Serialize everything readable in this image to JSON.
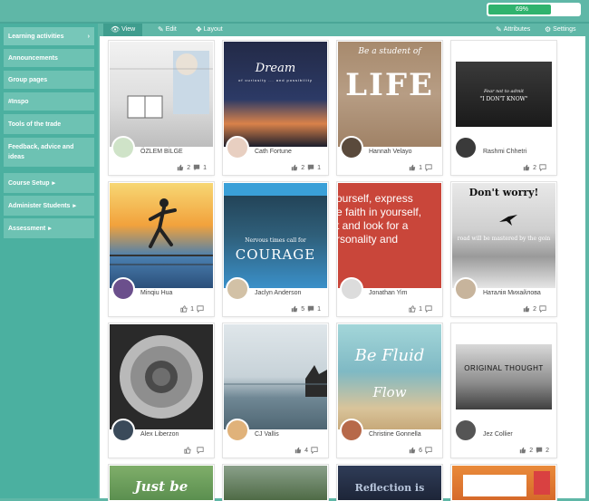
{
  "progress": {
    "label": "69%",
    "value": 0.69
  },
  "sidebar": {
    "items": [
      {
        "label": "Learning activities",
        "chevron": "›",
        "active": true
      },
      {
        "label": "Announcements",
        "chevron": ""
      },
      {
        "label": "Group pages",
        "chevron": ""
      },
      {
        "label": "#Inspo",
        "chevron": ""
      },
      {
        "label": "Tools of the trade",
        "chevron": ""
      },
      {
        "label": "Feedback, advice and ideas",
        "chevron": ""
      },
      {
        "label": "Course Setup",
        "chevron": "▸"
      },
      {
        "label": "Administer Students",
        "chevron": "▸"
      },
      {
        "label": "Assessment",
        "chevron": "▸"
      }
    ]
  },
  "toolbar": {
    "view_label": "View",
    "edit_label": "Edit",
    "layout_label": "Layout",
    "attributes_label": "Attributes",
    "settings_label": "Settings"
  },
  "cards": [
    {
      "name": "ÖZLEM BİLGE",
      "likes": "2",
      "comments": "1",
      "caption": "",
      "subcaption": ""
    },
    {
      "name": "Cath Fortune",
      "likes": "2",
      "comments": "1",
      "caption": "Dream",
      "subcaption": "of curiosity ... and possibility"
    },
    {
      "name": "Hannah Velayo",
      "likes": "1",
      "comments": "",
      "caption": "LIFE",
      "subcaption": "Be a student of"
    },
    {
      "name": "Rashmi Chhetri",
      "likes": "2",
      "comments": "",
      "caption": "\"I DON'T KNOW\"",
      "subcaption": "Fear not to admit"
    },
    {
      "name": "Minqiu Hua",
      "likes": "1",
      "comments": "",
      "caption": "",
      "subcaption": ""
    },
    {
      "name": "Jaclyn Anderson",
      "likes": "5",
      "comments": "1",
      "caption": "COURAGE",
      "subcaption": "Nervous times call for"
    },
    {
      "name": "Jonathan Yim",
      "likes": "1",
      "comments": "",
      "caption": "ourself, express\ne faith in yourself,\nt and look for a\nrsonality and",
      "subcaption": ""
    },
    {
      "name": "Наталія Михайлова",
      "likes": "2",
      "comments": "",
      "caption": "Don't worry!",
      "subcaption": "road will be mastered by the goin"
    },
    {
      "name": "Alex Liberzon",
      "likes": "",
      "comments": "",
      "caption": "",
      "subcaption": ""
    },
    {
      "name": "CJ Vallis",
      "likes": "4",
      "comments": "",
      "caption": "",
      "subcaption": ""
    },
    {
      "name": "Christine Gonnella",
      "likes": "6",
      "comments": "",
      "caption": "Be Fluid",
      "subcaption": "Flow"
    },
    {
      "name": "Jez Collier",
      "likes": "2",
      "comments": "2",
      "caption": "ORIGINAL THOUGHT",
      "subcaption": ""
    },
    {
      "name": "",
      "likes": "",
      "comments": "",
      "caption": "Just be",
      "subcaption": ""
    },
    {
      "name": "",
      "likes": "",
      "comments": "",
      "caption": "",
      "subcaption": ""
    },
    {
      "name": "",
      "likes": "",
      "comments": "",
      "caption": "Reflection is",
      "subcaption": ""
    },
    {
      "name": "",
      "likes": "",
      "comments": "",
      "caption": "",
      "subcaption": ""
    }
  ],
  "colors": {
    "teal": "#5fb7a7",
    "sidebar": "#4bb0a0",
    "progress": "#2fb36e"
  }
}
